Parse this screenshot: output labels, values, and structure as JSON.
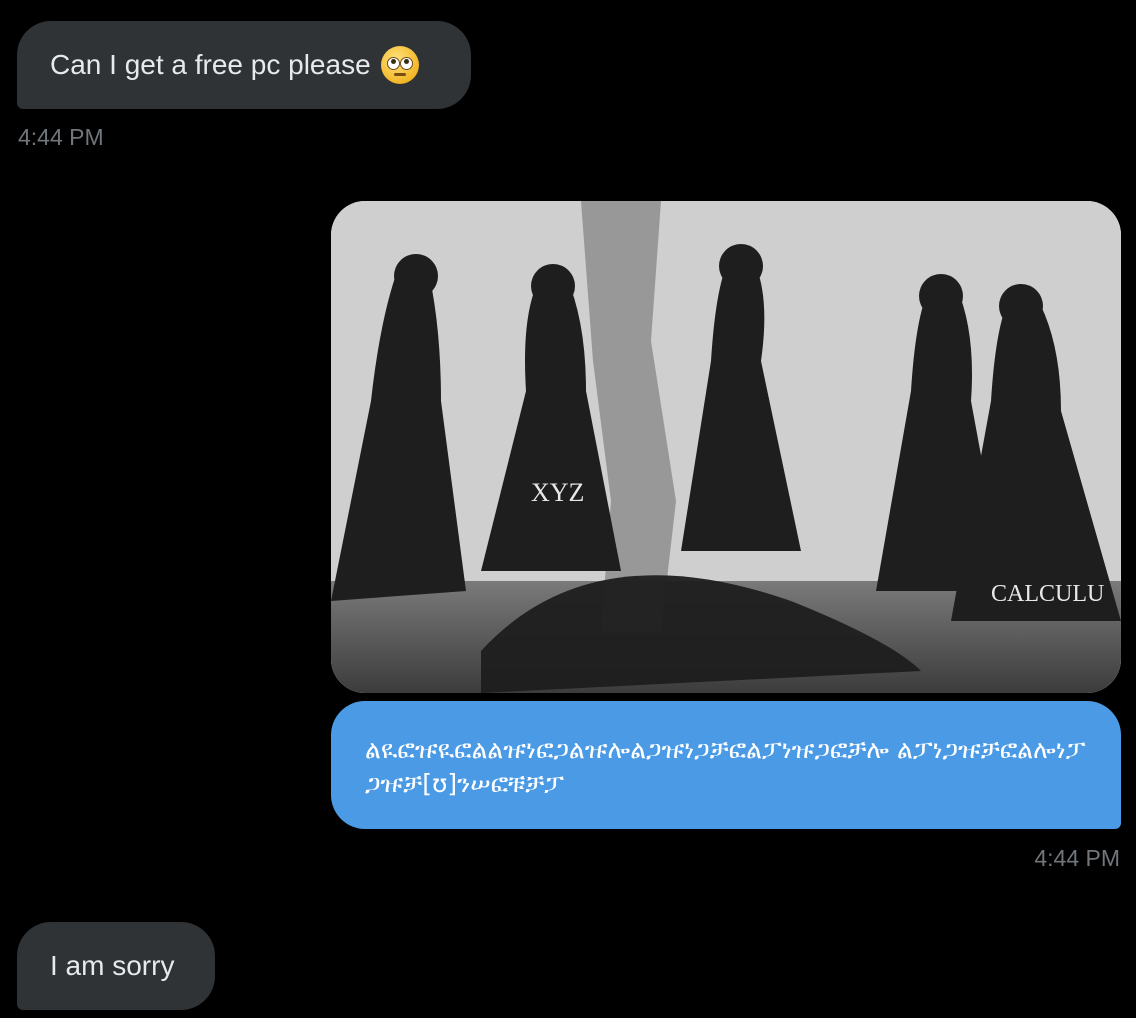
{
  "messages": [
    {
      "direction": "incoming",
      "text": "Can I get a free pc please",
      "emoji": "face-with-rolling-eyes"
    },
    {
      "direction": "outgoing",
      "text": "ልዪፎዡዪፎልልዡነፎጋልዡሎልጋዡነጋቻፎልፓነዡጋፎቻሎ ልፓነጋዡቻፎልሎነፓጋዡቻ[ʊ]ንሠፎቹቻፓ"
    },
    {
      "direction": "incoming",
      "text": "I am sorry"
    }
  ],
  "timestamps": [
    "4:44 PM",
    "4:44 PM"
  ],
  "image": {
    "labels": [
      "XYZ",
      "CALCULU"
    ]
  },
  "colors": {
    "background": "#000000",
    "incoming_bubble": "#2f3336",
    "outgoing_bubble": "#4a9ae6",
    "timestamp": "#71767b"
  }
}
